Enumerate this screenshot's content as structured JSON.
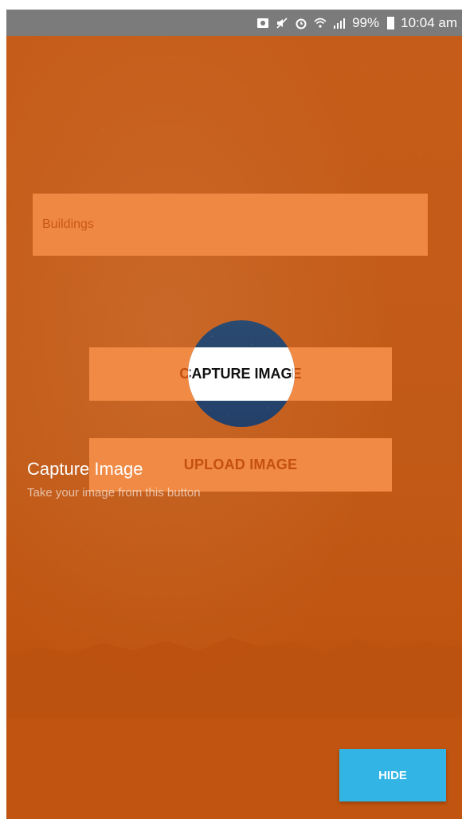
{
  "status_bar": {
    "battery": "99%",
    "time": "10:04 am",
    "icons": [
      "photo-icon",
      "mute-icon",
      "alarm-icon",
      "wifi-icon",
      "signal-icon",
      "battery-icon"
    ]
  },
  "form": {
    "category_field": "Buildings"
  },
  "buttons": {
    "capture": "CAPTURE IMAGE",
    "upload": "UPLOAD IMAGE",
    "hide": "HIDE"
  },
  "showcase": {
    "title": "Capture Image",
    "description": "Take your image from this button"
  },
  "colors": {
    "overlay": "#c45a18",
    "field": "#ef8842",
    "hide_button": "#32b5e5"
  }
}
